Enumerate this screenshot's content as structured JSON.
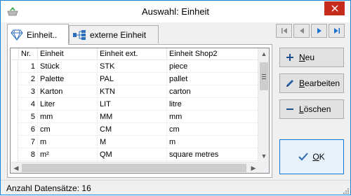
{
  "window": {
    "title": "Auswahl: Einheit"
  },
  "tabs": [
    {
      "label": "Einheit..",
      "icon": "diamond-icon",
      "active": true
    },
    {
      "label": "externe Einheit",
      "icon": "hierarchy-icon",
      "active": false
    }
  ],
  "nav": {
    "buttons": [
      {
        "name": "first-record-button",
        "icon": "first-icon"
      },
      {
        "name": "prev-record-button",
        "icon": "prev-icon"
      },
      {
        "name": "next-record-button",
        "icon": "next-icon"
      },
      {
        "name": "last-record-button",
        "icon": "last-icon"
      }
    ]
  },
  "grid": {
    "columns": [
      "Nr.",
      "Einheit",
      "Einheit ext.",
      "Einheit Shop2"
    ],
    "rows": [
      {
        "nr": "1",
        "einheit": "Stück",
        "ext": "STK",
        "shop": "piece"
      },
      {
        "nr": "2",
        "einheit": "Palette",
        "ext": "PAL",
        "shop": "pallet"
      },
      {
        "nr": "3",
        "einheit": "Karton",
        "ext": "KTN",
        "shop": "carton"
      },
      {
        "nr": "4",
        "einheit": "Liter",
        "ext": "LIT",
        "shop": "litre"
      },
      {
        "nr": "5",
        "einheit": "mm",
        "ext": "MM",
        "shop": "mm"
      },
      {
        "nr": "6",
        "einheit": "cm",
        "ext": "CM",
        "shop": "cm"
      },
      {
        "nr": "7",
        "einheit": "m",
        "ext": "M",
        "shop": "m"
      },
      {
        "nr": "8",
        "einheit": "m²",
        "ext": "QM",
        "shop": "square metres"
      }
    ]
  },
  "actions": {
    "new_prefix": "",
    "new_key": "N",
    "new_rest": "eu",
    "edit_prefix": "",
    "edit_key": "B",
    "edit_rest": "earbeiten",
    "delete_prefix": "",
    "delete_key": "L",
    "delete_rest": "öschen",
    "ok_prefix": "",
    "ok_key": "O",
    "ok_rest": "K"
  },
  "status": {
    "text": "Anzahl Datensätze: 16"
  },
  "colors": {
    "accent": "#0078d7",
    "close": "#c42b1c",
    "nav_icon": "#1e6fd0",
    "ok_check": "#2b6cb0"
  }
}
